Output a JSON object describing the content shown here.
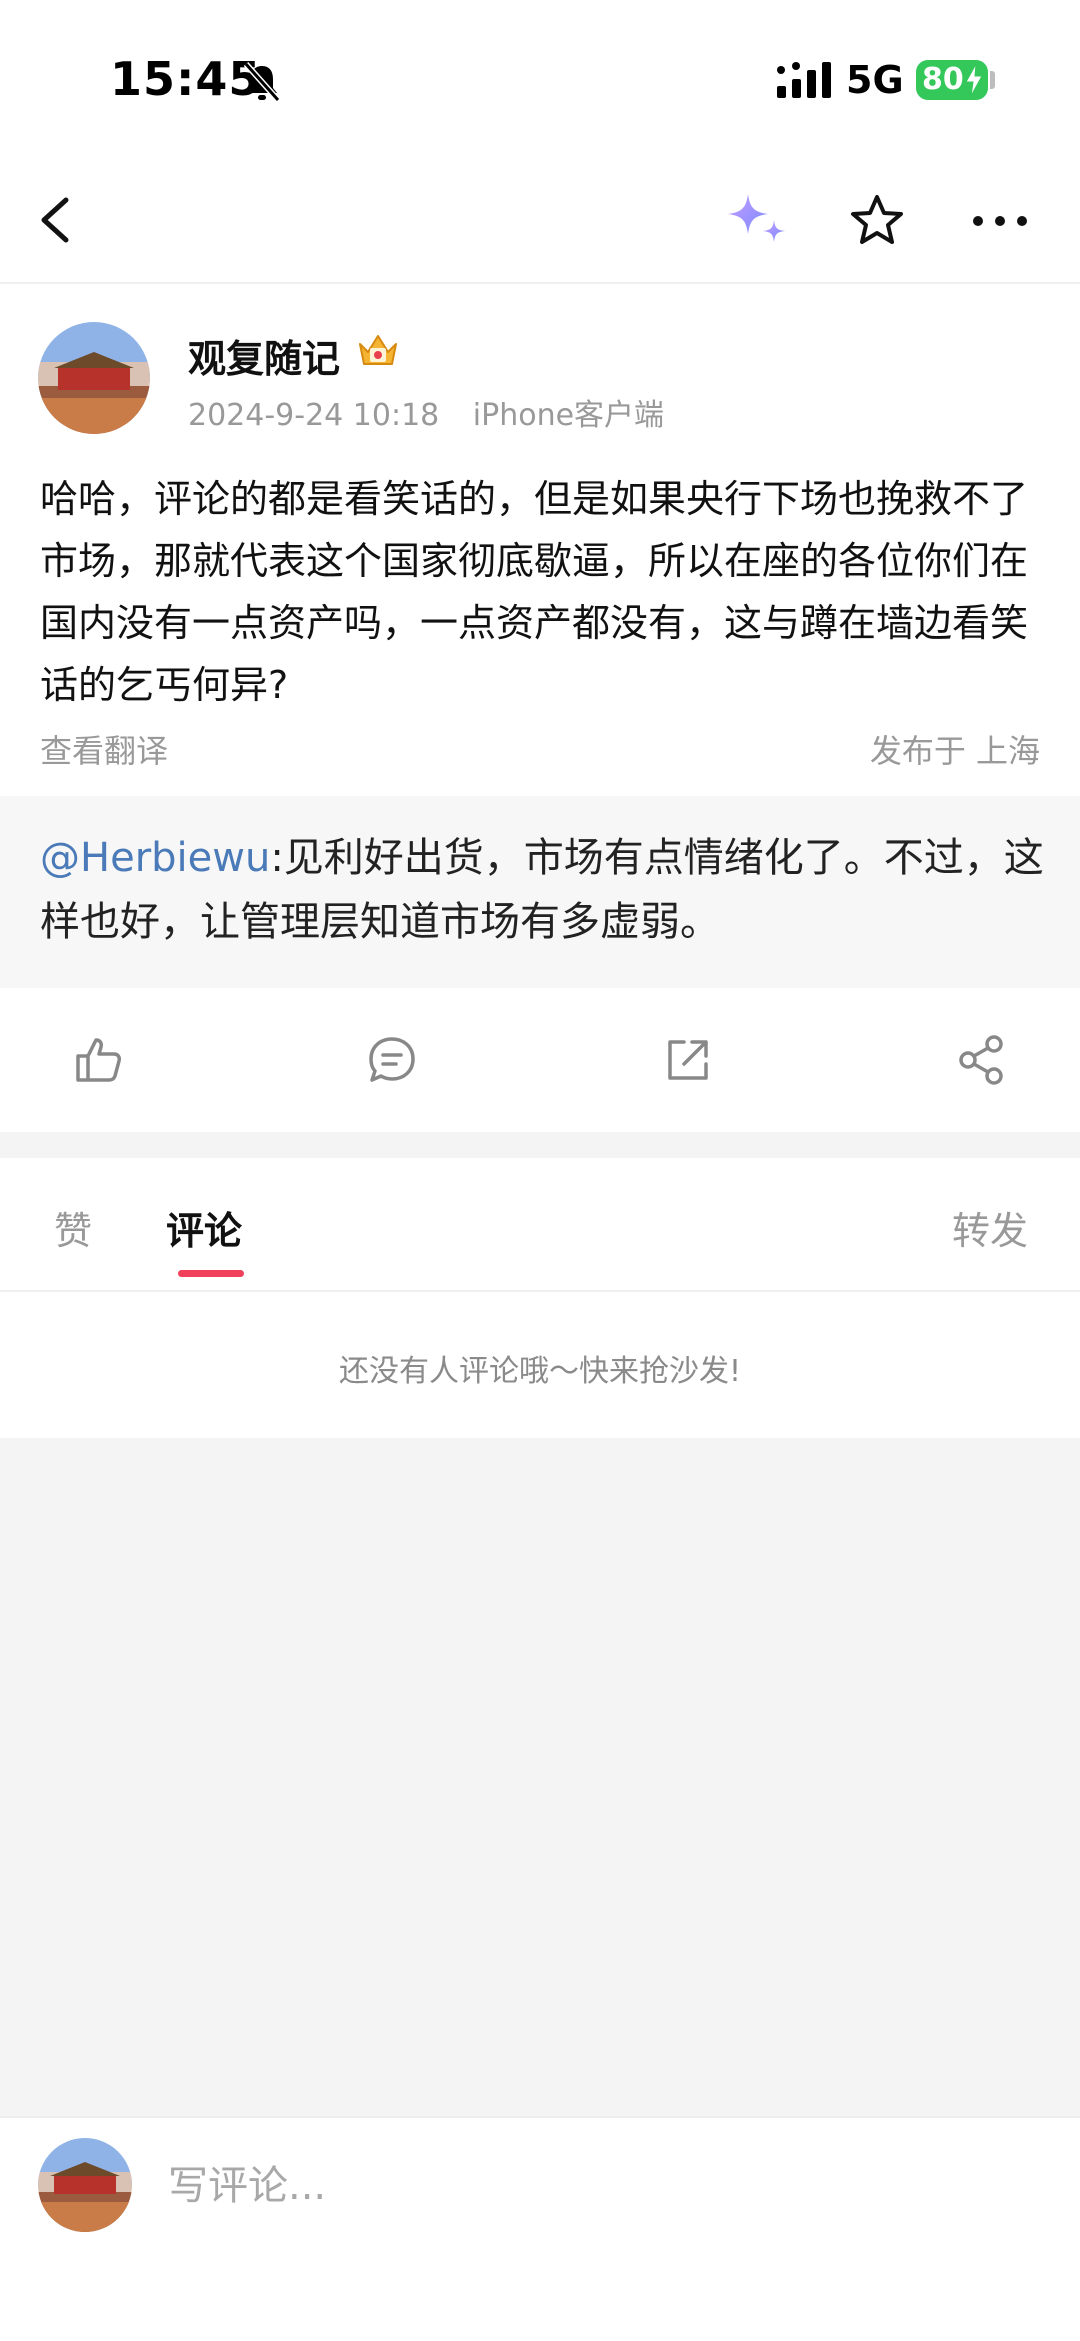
{
  "status_bar": {
    "time": "15:45",
    "network": "5G",
    "battery": "80"
  },
  "nav": {
    "icons": [
      "back-icon",
      "ai-sparkle-icon",
      "star-icon",
      "more-icon"
    ],
    "sparkle_colors": [
      "#b48cff",
      "#7a8dff"
    ]
  },
  "post": {
    "author": "观复随记",
    "date": "2024-9-24 10:18",
    "client": "iPhone客户端",
    "text": "哈哈，评论的都是看笑话的，但是如果央行下场也挽救不了市场，那就代表这个国家彻底歇逼，所以在座的各位你们在国内没有一点资产吗，一点资产都没有，这与蹲在墙边看笑话的乞丐何异?",
    "translate_label": "查看翻译",
    "location": "发布于 上海"
  },
  "quoted": {
    "mention": "@Herbiewu",
    "text": ":见利好出货，市场有点情绪化了。不过，这样也好，让管理层知道市场有多虚弱。"
  },
  "actions": {
    "icons": [
      "like-icon",
      "comment-icon",
      "repost-icon",
      "share-icon"
    ]
  },
  "tabs": {
    "like": "赞",
    "comment": "评论",
    "repost": "转发",
    "accent": "#f0405a"
  },
  "empty_state": "还没有人评论哦～快来抢沙发!",
  "comment_bar": {
    "placeholder": "写评论..."
  }
}
